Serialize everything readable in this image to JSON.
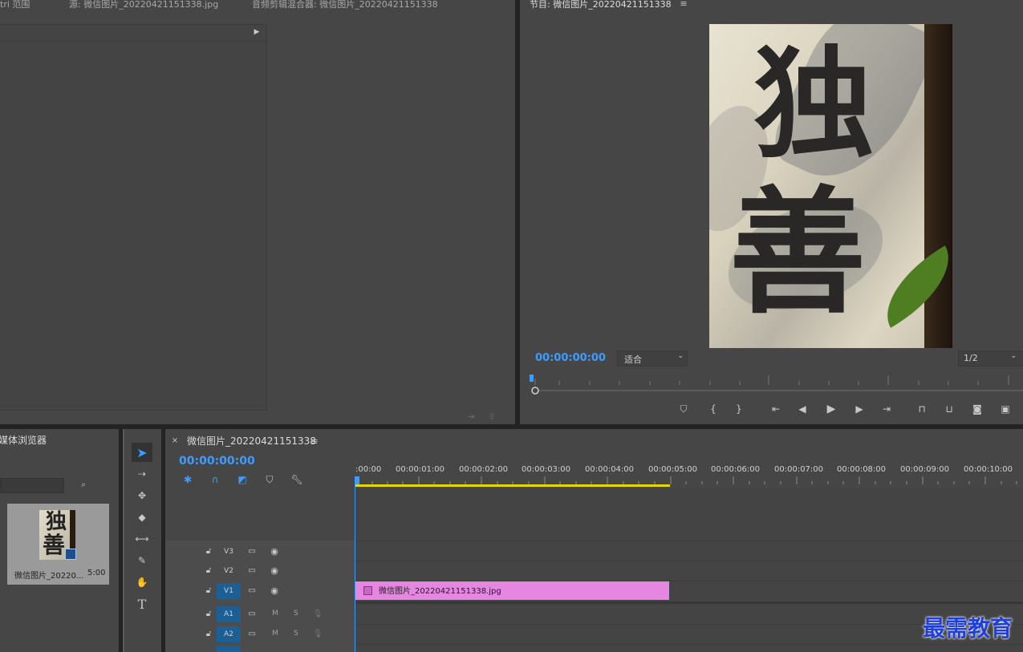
{
  "source_tabs": [
    {
      "label": "tri 范围"
    },
    {
      "label": "源: 微信图片_20220421151338.jpg"
    },
    {
      "label": "音频剪辑混合器: 微信图片_20220421151338"
    }
  ],
  "program": {
    "title": "节目: 微信图片_20220421151338",
    "timecode": "00:00:00:00",
    "fit_label": "适合",
    "resolution": "1/2",
    "image_chars": [
      "独",
      "善"
    ]
  },
  "media_browser": {
    "title": "媒体浏览器"
  },
  "project_item": {
    "name": "微信图片_20220...",
    "duration": "5:00"
  },
  "timeline": {
    "tab_label": "微信图片_20220421151338",
    "timecode": "00:00:00:00",
    "ruler": [
      ":00:00",
      "00:00:01:00",
      "00:00:02:00",
      "00:00:03:00",
      "00:00:04:00",
      "00:00:05:00",
      "00:00:06:00",
      "00:00:07:00",
      "00:00:08:00",
      "00:00:09:00",
      "00:00:10:00"
    ],
    "tracks": [
      {
        "name": "V3",
        "type": "video",
        "targeted": false
      },
      {
        "name": "V2",
        "type": "video",
        "targeted": false
      },
      {
        "name": "V1",
        "type": "video",
        "targeted": true
      },
      {
        "name": "A1",
        "type": "audio",
        "targeted": true
      },
      {
        "name": "A2",
        "type": "audio",
        "targeted": true
      }
    ],
    "mute_label": "M",
    "solo_label": "S",
    "clip": {
      "label": "微信图片_20220421151338.jpg",
      "color": "#e586e0"
    }
  },
  "watermark": "最需教育",
  "colors": {
    "accent": "#3d9cff",
    "work_area": "#e6d600",
    "panel": "#464646"
  }
}
